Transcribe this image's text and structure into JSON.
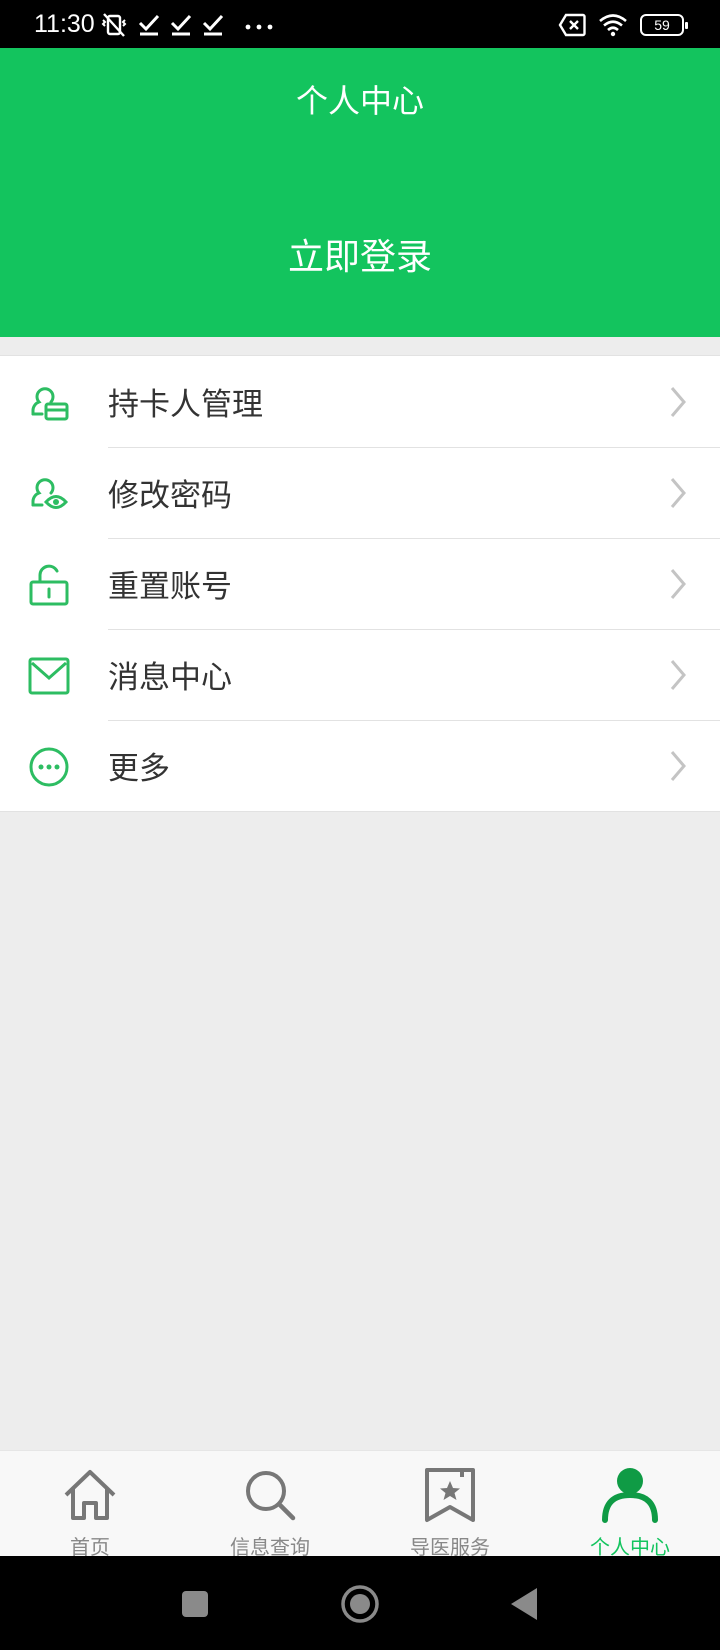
{
  "status_bar": {
    "time": "11:30",
    "battery": "59",
    "icons": [
      "vibrate-off-icon",
      "check-icon",
      "check-icon",
      "check-icon",
      "more-dots-icon",
      "no-sim-icon",
      "wifi-icon",
      "battery-icon"
    ]
  },
  "header": {
    "title": "个人中心",
    "login_label": "立即登录"
  },
  "menu": {
    "items": [
      {
        "label": "持卡人管理",
        "icon": "cardholder-icon"
      },
      {
        "label": "修改密码",
        "icon": "user-key-icon"
      },
      {
        "label": "重置账号",
        "icon": "unlock-icon"
      },
      {
        "label": "消息中心",
        "icon": "mail-icon"
      },
      {
        "label": "更多",
        "icon": "more-circle-icon"
      }
    ]
  },
  "tabbar": {
    "tabs": [
      {
        "label": "首页",
        "icon": "home-icon",
        "active": false
      },
      {
        "label": "信息查询",
        "icon": "search-icon",
        "active": false
      },
      {
        "label": "导医服务",
        "icon": "bookmark-star-icon",
        "active": false
      },
      {
        "label": "个人中心",
        "icon": "person-icon",
        "active": true
      }
    ]
  },
  "colors": {
    "accent": "#13c45e",
    "icon_green": "#2dbd62",
    "tab_inactive": "#888888",
    "background": "#ededed"
  }
}
